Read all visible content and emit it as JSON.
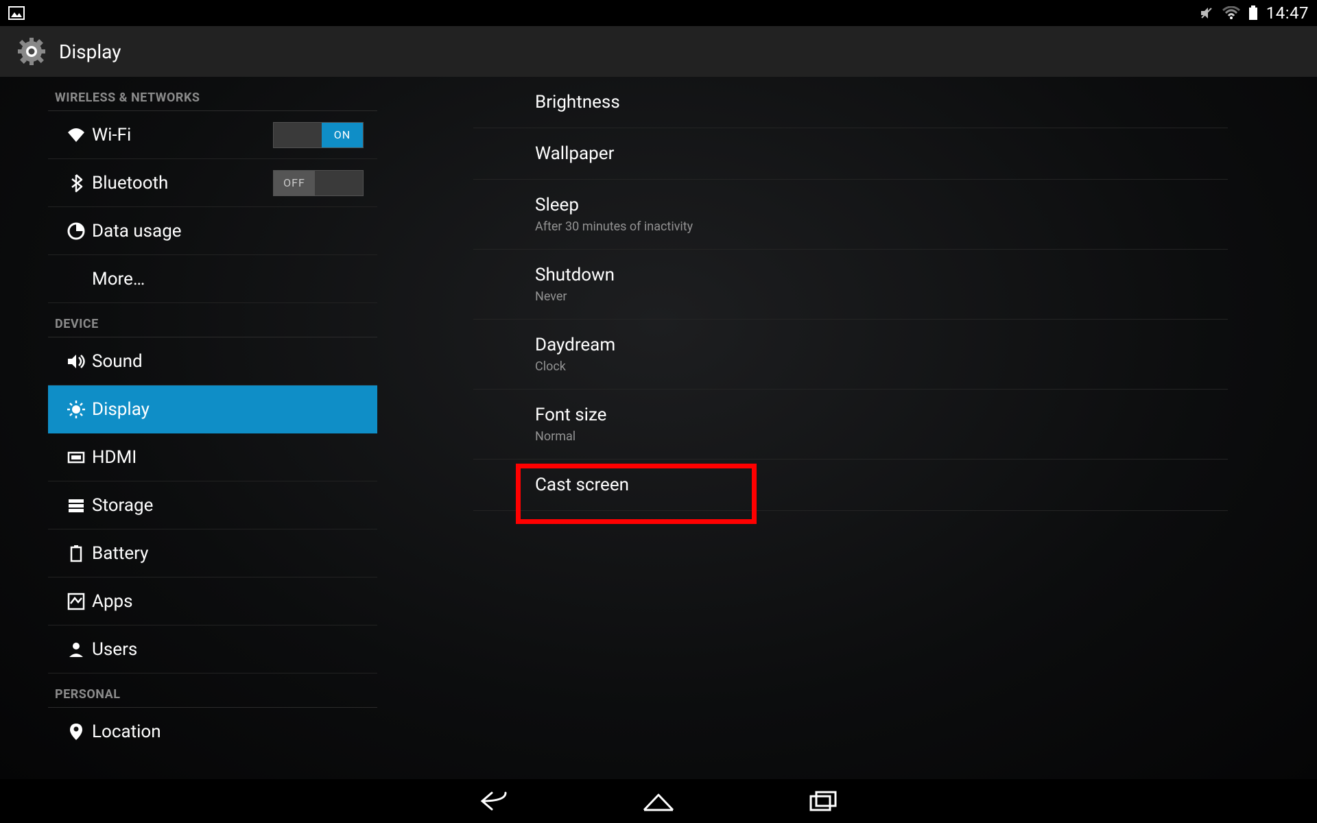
{
  "statusbar": {
    "time": "14:47"
  },
  "header": {
    "title": "Display"
  },
  "sidebar": {
    "sections": [
      {
        "header": "WIRELESS & NETWORKS",
        "items": [
          {
            "label": "Wi-Fi",
            "toggle": "ON"
          },
          {
            "label": "Bluetooth",
            "toggle": "OFF"
          },
          {
            "label": "Data usage"
          },
          {
            "label": "More…"
          }
        ]
      },
      {
        "header": "DEVICE",
        "items": [
          {
            "label": "Sound"
          },
          {
            "label": "Display"
          },
          {
            "label": "HDMI"
          },
          {
            "label": "Storage"
          },
          {
            "label": "Battery"
          },
          {
            "label": "Apps"
          },
          {
            "label": "Users"
          }
        ]
      },
      {
        "header": "PERSONAL",
        "items": [
          {
            "label": "Location"
          }
        ]
      }
    ]
  },
  "main": {
    "items": [
      {
        "title": "Brightness"
      },
      {
        "title": "Wallpaper"
      },
      {
        "title": "Sleep",
        "sub": "After 30 minutes of inactivity"
      },
      {
        "title": "Shutdown",
        "sub": "Never"
      },
      {
        "title": "Daydream",
        "sub": "Clock"
      },
      {
        "title": "Font size",
        "sub": "Normal"
      },
      {
        "title": "Cast screen"
      }
    ]
  }
}
